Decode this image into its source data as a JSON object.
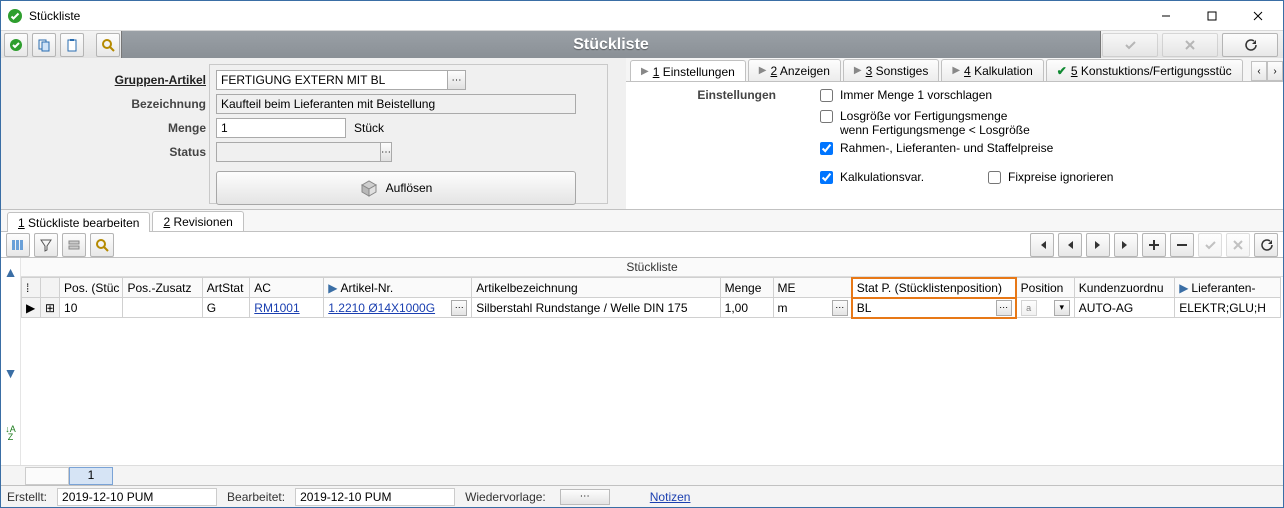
{
  "window": {
    "title": "Stückliste"
  },
  "headband": {
    "title": "Stückliste"
  },
  "form": {
    "labels": {
      "gruppenArtikel": "Gruppen-Artikel",
      "bezeichnung": "Bezeichnung",
      "menge": "Menge",
      "status": "Status"
    },
    "gruppenArtikel": "FERTIGUNG EXTERN MIT BL",
    "bezeichnung": "Kaufteil beim Lieferanten mit Beistellung",
    "menge": "1",
    "mengeUnit": "Stück",
    "status": "",
    "aufloesen": "Auflösen"
  },
  "topTabs": {
    "einstellungen": "Einstellungen",
    "anzeigen": "Anzeigen",
    "sonstiges": "Sonstiges",
    "kalkulation": "Kalkulation",
    "konstruktion": "Konstuktions/Fertigungsstüc",
    "keys": {
      "k1": "1",
      "k2": "2",
      "k3": "3",
      "k4": "4",
      "k5": "5"
    }
  },
  "settings": {
    "sectionTitle": "Einstellungen",
    "immerMenge1": {
      "label": "Immer Menge 1 vorschlagen",
      "checked": false
    },
    "losgroesse": {
      "label": "Losgröße vor Fertigungsmenge",
      "sub": "wenn Fertigungsmenge < Losgröße",
      "checked": false
    },
    "rahmen": {
      "label": "Rahmen-, Lieferanten- und Staffelpreise",
      "checked": true
    },
    "kalkvar": {
      "label": "Kalkulationsvar.",
      "checked": true
    },
    "fixpreise": {
      "label": "Fixpreise ignorieren",
      "checked": false
    }
  },
  "subTabs": {
    "bearbeiten": "Stückliste bearbeiten",
    "revisionen": "Revisionen",
    "keys": {
      "k1": "1",
      "k2": "2"
    }
  },
  "grid": {
    "caption": "Stückliste",
    "headers": {
      "pos": "Pos. (Stüc",
      "posZusatz": "Pos.-Zusatz",
      "artStat": "ArtStat",
      "ac": "AC",
      "artikelNr": "Artikel-Nr.",
      "artikelBez": "Artikelbezeichnung",
      "menge": "Menge",
      "me": "ME",
      "statP": "Stat P. (Stücklistenposition)",
      "position": "Position",
      "kunden": "Kundenzuordnu",
      "lieferanten": "Lieferanten-"
    },
    "row": {
      "pos": "10",
      "posZusatz": "",
      "artStat": "G",
      "ac": "RM1001",
      "artikelNr": "1.2210 Ø14X1000G",
      "artikelBez": "Silberstahl Rundstange / Welle DIN 175",
      "menge": "1,00",
      "me": "m",
      "statP": "BL",
      "positionLabel": "a",
      "kunden": "AUTO-AG",
      "lieferanten": "ELEKTR;GLU;H"
    }
  },
  "pager": {
    "current": "1"
  },
  "status": {
    "erstelltLbl": "Erstellt:",
    "erstelltVal": "2019-12-10  PUM",
    "bearbeitetLbl": "Bearbeitet:",
    "bearbeitetVal": "2019-12-10  PUM",
    "wiedervorlageLbl": "Wiedervorlage:",
    "notizen": "Notizen"
  }
}
